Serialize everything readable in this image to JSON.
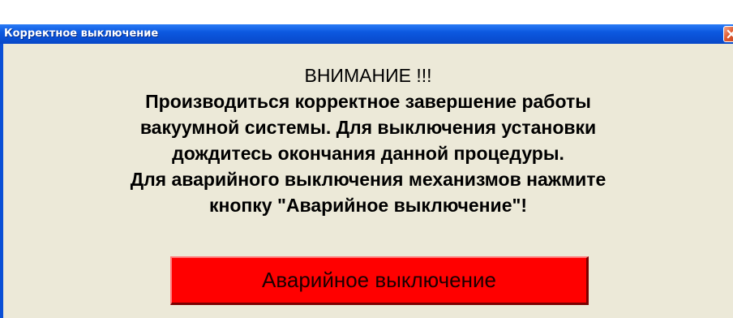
{
  "window": {
    "title": "Корректное выключение"
  },
  "message": {
    "heading": "ВНИМАНИЕ !!!",
    "lines": [
      "Производиться корректное завершение работы",
      "вакуумной системы. Для выключения установки",
      "дождитесь окончания данной процедуры.",
      "Для аварийного выключения механизмов нажмите",
      "кнопку \"Аварийное выключение\"!"
    ]
  },
  "emergency_button": {
    "label": "Аварийное выключение",
    "color": "#ff0000"
  },
  "icons": {
    "close": "close-icon"
  }
}
